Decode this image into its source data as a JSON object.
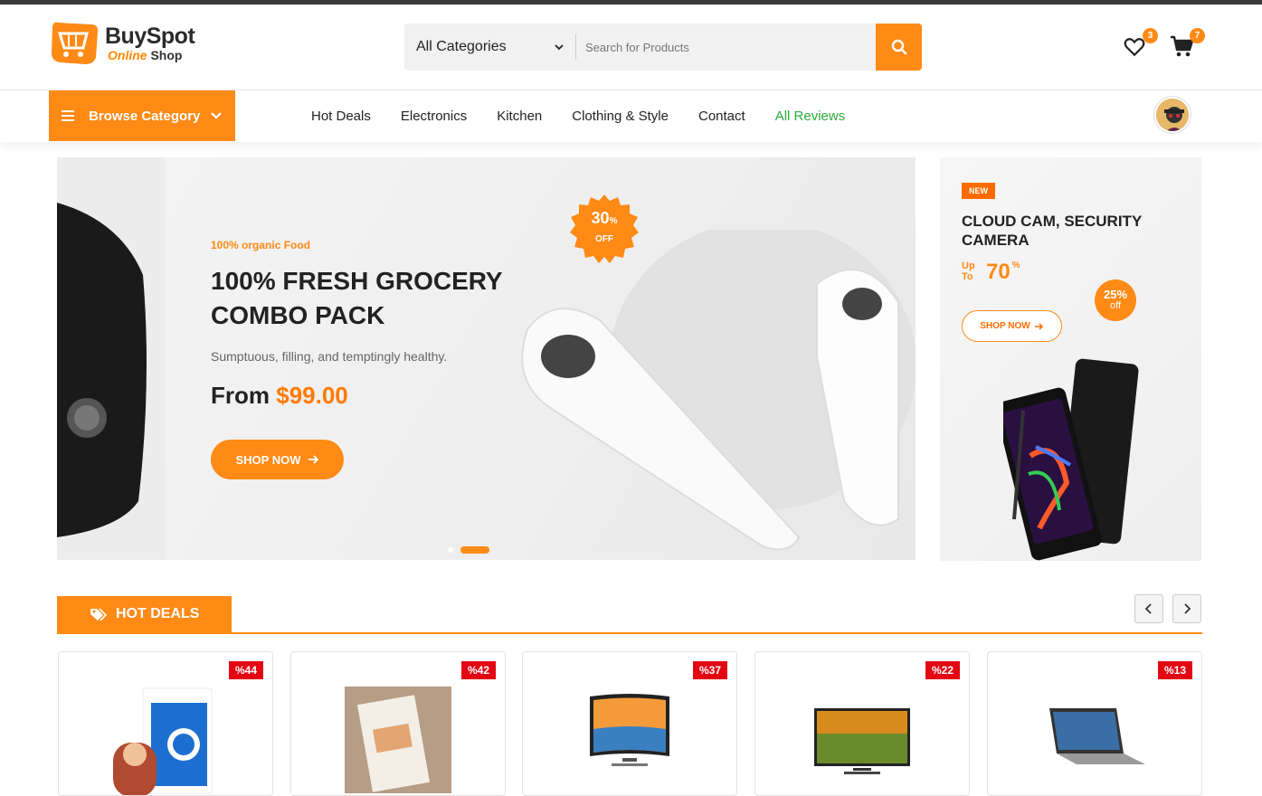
{
  "brand": {
    "name": "BuySpot",
    "sub_a": "Online",
    "sub_b": "Shop"
  },
  "search": {
    "category": "All Categories",
    "placeholder": "Search for Products"
  },
  "header": {
    "wishlist_count": "3",
    "cart_count": "7"
  },
  "nav": {
    "browse_label": "Browse Category",
    "links": [
      "Hot Deals",
      "Electronics",
      "Kitchen",
      "Clothing & Style",
      "Contact",
      "All Reviews"
    ]
  },
  "hero": {
    "tagline": "100% organic Food",
    "title": "100% FRESH GROCERY COMBO PACK",
    "description": "Sumptuous, filling, and temptingly healthy.",
    "price_prefix": "From",
    "price": "$99.00",
    "badge_value": "30",
    "badge_pct": "%",
    "badge_off": "OFF",
    "button": "SHOP NOW"
  },
  "side_banner": {
    "badge": "NEW",
    "title": "CLOUD CAM, SECURITY CAMERA",
    "upto_line1": "Up",
    "upto_line2": "To",
    "upto_value": "70",
    "upto_pct": "%",
    "discount": "25%",
    "discount_sub": "off",
    "button": "SHOP NOW"
  },
  "hot_deals": {
    "title": "HOT DEALS",
    "products": [
      {
        "discount": "%44",
        "image": "book-lean-startup"
      },
      {
        "discount": "%42",
        "image": "book-atomic-habits"
      },
      {
        "discount": "%37",
        "image": "curved-tv"
      },
      {
        "discount": "%22",
        "image": "qled-tv"
      },
      {
        "discount": "%13",
        "image": "laptop"
      }
    ]
  },
  "colors": {
    "accent": "#ff8a16",
    "green": "#2bab3b",
    "red": "#e30613"
  }
}
